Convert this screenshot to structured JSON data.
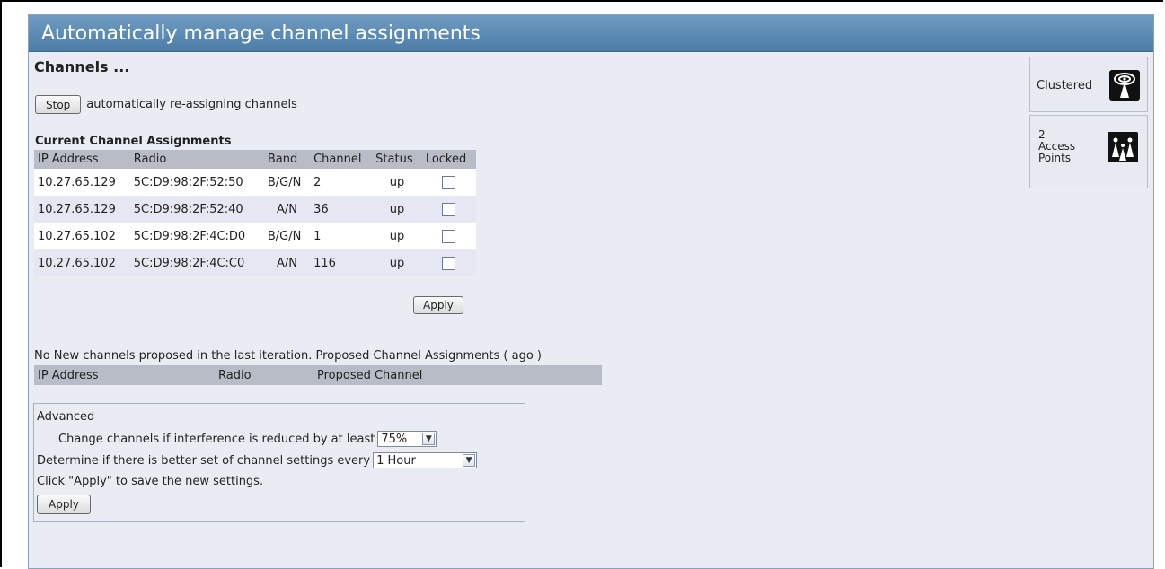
{
  "title": "Automatically manage channel assignments",
  "heading": "Channels ...",
  "stop": {
    "button_label": "Stop",
    "description": "automatically re-assigning channels"
  },
  "current": {
    "label": "Current Channel Assignments",
    "columns": [
      "IP Address",
      "Radio",
      "Band",
      "Channel",
      "Status",
      "Locked"
    ],
    "rows": [
      {
        "ip": "10.27.65.129",
        "radio": "5C:D9:98:2F:52:50",
        "band": "B/G/N",
        "channel": "2",
        "status": "up",
        "locked": false
      },
      {
        "ip": "10.27.65.129",
        "radio": "5C:D9:98:2F:52:40",
        "band": "A/N",
        "channel": "36",
        "status": "up",
        "locked": false
      },
      {
        "ip": "10.27.65.102",
        "radio": "5C:D9:98:2F:4C:D0",
        "band": "B/G/N",
        "channel": "1",
        "status": "up",
        "locked": false
      },
      {
        "ip": "10.27.65.102",
        "radio": "5C:D9:98:2F:4C:C0",
        "band": "A/N",
        "channel": "116",
        "status": "up",
        "locked": false
      }
    ],
    "apply_label": "Apply"
  },
  "proposed": {
    "message": "No New channels proposed in the last iteration. Proposed Channel Assignments ( ago )",
    "columns": [
      "IP Address",
      "Radio",
      "Proposed Channel"
    ]
  },
  "advanced": {
    "label": "Advanced",
    "interference_label": "Change channels if interference is reduced by at least",
    "interference_value": "75%",
    "interval_label": "Determine if there is better set of channel settings every",
    "interval_value": "1 Hour",
    "hint": "Click \"Apply\" to save the new settings.",
    "apply_label": "Apply"
  },
  "sidebar": {
    "cluster_label": "Clustered",
    "ap_count": "2",
    "ap_label_line1": "Access",
    "ap_label_line2": "Points"
  },
  "icons": {
    "cluster": "cluster-icon",
    "access_points": "access-points-icon"
  }
}
